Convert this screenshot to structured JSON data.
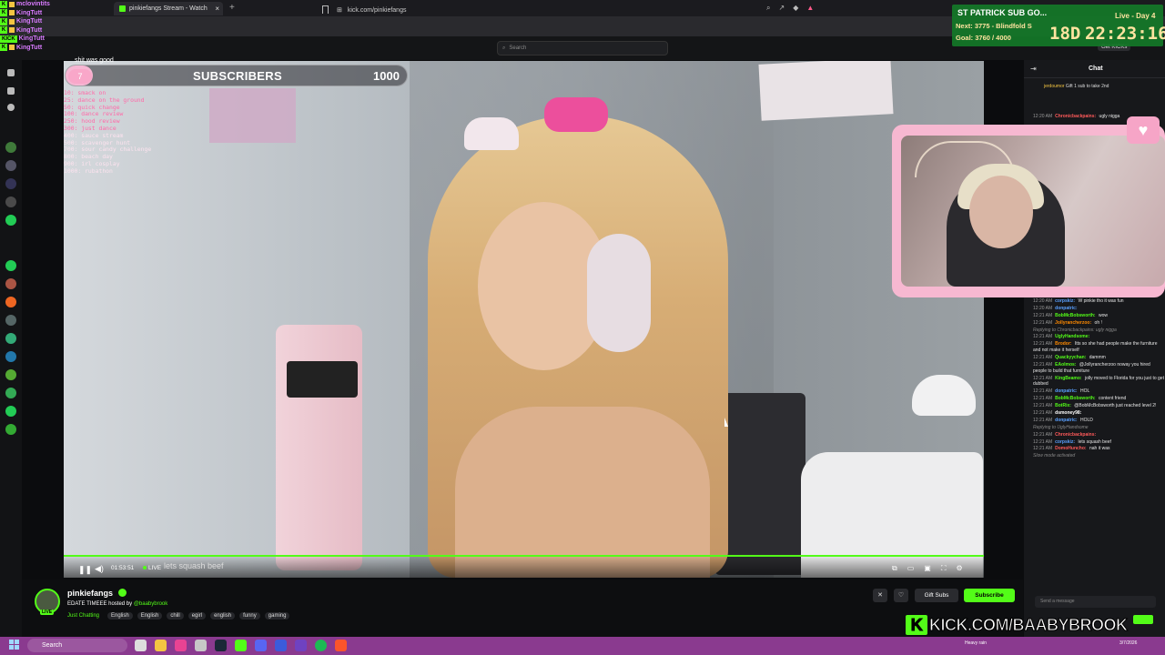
{
  "browser": {
    "tab_title": "pinkiefangs Stream - Watch",
    "new_tab": "+",
    "url": "kick.com/pinkiefangs"
  },
  "kick_nav": {
    "search_placeholder": "Search",
    "get_kicks": "Get KICKs"
  },
  "overlay_chat": {
    "lines": [
      {
        "name": "mclovintits"
      },
      {
        "name": "KingTutt"
      },
      {
        "name": "KingTutt"
      },
      {
        "name": "KingTutt"
      },
      {
        "name": "KingTutt"
      },
      {
        "name": "KingTutt"
      }
    ],
    "kick_watermark": "KICK",
    "last_msg": "shit was good"
  },
  "sub_goal": {
    "current": "7",
    "title": "SUBSCRIBERS",
    "goal": "1000",
    "progress_fraction": 0.007,
    "fill_color": "#f7b6d3"
  },
  "goal_list": [
    "10: smack on",
    "25: dance on the ground",
    "50: quick change",
    "100: dance review",
    "250: hood review",
    "300: just dance",
    "400: sauce stream",
    "500: scavenger hunt",
    "700: sour candy challenge",
    "800: beach day",
    "900: irl cosplay",
    "1000: rubathon"
  ],
  "player": {
    "time": "01:53:51",
    "live_label": "LIVE",
    "caption": "lets squash beef"
  },
  "stream_info": {
    "channel": "pinkiefangs",
    "title_prefix": "EDATE TIMEEE hosted by",
    "host": "@baabybrook",
    "category": "Just Chatting",
    "tags": [
      "English",
      "English",
      "chill",
      "egirl",
      "english",
      "funny",
      "gaming"
    ],
    "gift_subs": "Gift Subs",
    "subscribe": "Subscribe",
    "live_badge": "LIVE"
  },
  "chat": {
    "title": "Chat",
    "pinned_user": "jerdoumor",
    "pinned_text": "Gift 1 sub to take 2nd",
    "top_lines": [
      {
        "time": "12:20 AM",
        "user": "Chronicbackpains",
        "color": "#ff5a5a",
        "text": "ugly nigga"
      }
    ],
    "lines": [
      {
        "time": "12:20 AM",
        "user": "corpskiz",
        "color": "#5aa0ff",
        "text": "W pinkie tho it was fun"
      },
      {
        "time": "12:20 AM",
        "user": "donpatric",
        "color": "#5aa0ff",
        "text": ""
      },
      {
        "time": "12:21 AM",
        "user": "BobMcBobsworth",
        "color": "#53fc18",
        "text": "wow"
      },
      {
        "time": "12:21 AM",
        "user": "Jollyrancherzoo",
        "color": "#ff8a00",
        "text": "oh !"
      },
      {
        "sys": "Replying to Chronicbackpains: ugly nigga"
      },
      {
        "time": "12:21 AM",
        "user": "UglyHandsome",
        "color": "#53fc18",
        "text": ""
      },
      {
        "time": "12:21 AM",
        "user": "Brodor",
        "color": "#ff8a00",
        "text": "Itts so she had people make the furniture and not make it herself"
      },
      {
        "time": "12:21 AM",
        "user": "Quackyychan",
        "color": "#53fc18",
        "text": "dammm"
      },
      {
        "time": "12:21 AM",
        "user": "EAolmos",
        "color": "#53fc18",
        "text": "@Jollyrancherzoo noway you hired people to build that furniture"
      },
      {
        "time": "12:21 AM",
        "user": "KingBeamo",
        "color": "#53fc18",
        "text": "jolly moved to Florida for you just to get dubbed"
      },
      {
        "time": "12:21 AM",
        "user": "donpatric",
        "color": "#5aa0ff",
        "text": "HOL"
      },
      {
        "time": "12:21 AM",
        "user": "BobMcBobsworth",
        "color": "#53fc18",
        "text": "content friend"
      },
      {
        "time": "12:21 AM",
        "user": "BotRix",
        "color": "#53fc18",
        "text": "@BobMcBobsworth just reached level 2!"
      },
      {
        "time": "12:21 AM",
        "user": "dsmoney98",
        "color": "#ffffff",
        "text": ""
      },
      {
        "time": "12:21 AM",
        "user": "donpatric",
        "color": "#5aa0ff",
        "text": "HOLD"
      },
      {
        "sys": "Replying to UglyHandsome"
      },
      {
        "time": "12:21 AM",
        "user": "Chronicbackpains",
        "color": "#ff5a5a",
        "text": ""
      },
      {
        "time": "12:21 AM",
        "user": "corpskiz",
        "color": "#5aa0ff",
        "text": "lets squash beef"
      },
      {
        "time": "12:21 AM",
        "user": "DomoHuncho",
        "color": "#ff5a5a",
        "text": "nah it was"
      },
      {
        "sys": "Slow mode activated"
      }
    ],
    "input_placeholder": "Send a message"
  },
  "stream_overlay": {
    "event": "ST PATRICK SUB GO...",
    "live_day": "Live - Day 4",
    "next": "Next: 3775 - Blindfold S",
    "goal": "Goal: 3760 / 4000",
    "days": "18D",
    "timer": "22:23:16",
    "kick_link": "KICK.COM/BAABYBROOK"
  },
  "taskbar": {
    "search": "Search",
    "tray": "Heavy rain",
    "clock": "3/7/2026"
  },
  "colors": {
    "kick_green": "#53fc18",
    "taskbar": "#8a3a8f",
    "overlay_green": "#147828",
    "cam_border": "#f7b8d1"
  }
}
